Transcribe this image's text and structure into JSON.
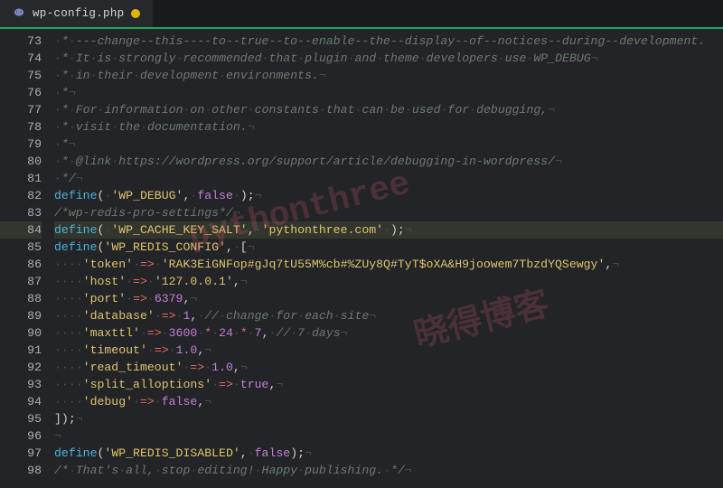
{
  "tab": {
    "filename": "wp-config.php",
    "modified": true,
    "icon": "php-elephant-icon"
  },
  "gutter": {
    "start": 73,
    "end": 98,
    "highlight": 84
  },
  "watermarks": [
    "pythonthree",
    "晓得博客"
  ],
  "handle": {
    "glyph": "‹"
  },
  "code": {
    "lines": [
      {
        "n": 73,
        "segs": [
          {
            "t": "·",
            "cls": "ws"
          },
          {
            "t": "*",
            "cls": "c"
          },
          {
            "t": "·",
            "cls": "ws"
          },
          {
            "t": "---change--this----to--true--to--enable--the--display--of--notices--during--development.",
            "cls": "c hidden"
          }
        ]
      },
      {
        "n": 74,
        "segs": [
          {
            "t": "·",
            "cls": "ws"
          },
          {
            "t": "*",
            "cls": "c"
          },
          {
            "t": "·",
            "cls": "ws"
          },
          {
            "t": "It",
            "cls": "c"
          },
          {
            "t": "·",
            "cls": "ws"
          },
          {
            "t": "is",
            "cls": "c"
          },
          {
            "t": "·",
            "cls": "ws"
          },
          {
            "t": "strongly",
            "cls": "c"
          },
          {
            "t": "·",
            "cls": "ws"
          },
          {
            "t": "recommended",
            "cls": "c"
          },
          {
            "t": "·",
            "cls": "ws"
          },
          {
            "t": "that",
            "cls": "c"
          },
          {
            "t": "·",
            "cls": "ws"
          },
          {
            "t": "plugin",
            "cls": "c"
          },
          {
            "t": "·",
            "cls": "ws"
          },
          {
            "t": "and",
            "cls": "c"
          },
          {
            "t": "·",
            "cls": "ws"
          },
          {
            "t": "theme",
            "cls": "c"
          },
          {
            "t": "·",
            "cls": "ws"
          },
          {
            "t": "developers",
            "cls": "c"
          },
          {
            "t": "·",
            "cls": "ws"
          },
          {
            "t": "use",
            "cls": "c"
          },
          {
            "t": "·",
            "cls": "ws"
          },
          {
            "t": "WP_DEBUG",
            "cls": "c"
          },
          {
            "t": "¬",
            "cls": "ws"
          }
        ]
      },
      {
        "n": 75,
        "segs": [
          {
            "t": "·",
            "cls": "ws"
          },
          {
            "t": "*",
            "cls": "c"
          },
          {
            "t": "·",
            "cls": "ws"
          },
          {
            "t": "in",
            "cls": "c"
          },
          {
            "t": "·",
            "cls": "ws"
          },
          {
            "t": "their",
            "cls": "c"
          },
          {
            "t": "·",
            "cls": "ws"
          },
          {
            "t": "development",
            "cls": "c"
          },
          {
            "t": "·",
            "cls": "ws"
          },
          {
            "t": "environments.",
            "cls": "c"
          },
          {
            "t": "¬",
            "cls": "ws"
          }
        ]
      },
      {
        "n": 76,
        "segs": [
          {
            "t": "·",
            "cls": "ws"
          },
          {
            "t": "*",
            "cls": "c"
          },
          {
            "t": "¬",
            "cls": "ws"
          }
        ]
      },
      {
        "n": 77,
        "segs": [
          {
            "t": "·",
            "cls": "ws"
          },
          {
            "t": "*",
            "cls": "c"
          },
          {
            "t": "·",
            "cls": "ws"
          },
          {
            "t": "For",
            "cls": "c"
          },
          {
            "t": "·",
            "cls": "ws"
          },
          {
            "t": "information",
            "cls": "c"
          },
          {
            "t": "·",
            "cls": "ws"
          },
          {
            "t": "on",
            "cls": "c"
          },
          {
            "t": "·",
            "cls": "ws"
          },
          {
            "t": "other",
            "cls": "c"
          },
          {
            "t": "·",
            "cls": "ws"
          },
          {
            "t": "constants",
            "cls": "c"
          },
          {
            "t": "·",
            "cls": "ws"
          },
          {
            "t": "that",
            "cls": "c"
          },
          {
            "t": "·",
            "cls": "ws"
          },
          {
            "t": "can",
            "cls": "c"
          },
          {
            "t": "·",
            "cls": "ws"
          },
          {
            "t": "be",
            "cls": "c"
          },
          {
            "t": "·",
            "cls": "ws"
          },
          {
            "t": "used",
            "cls": "c"
          },
          {
            "t": "·",
            "cls": "ws"
          },
          {
            "t": "for",
            "cls": "c"
          },
          {
            "t": "·",
            "cls": "ws"
          },
          {
            "t": "debugging,",
            "cls": "c"
          },
          {
            "t": "¬",
            "cls": "ws"
          }
        ]
      },
      {
        "n": 78,
        "segs": [
          {
            "t": "·",
            "cls": "ws"
          },
          {
            "t": "*",
            "cls": "c"
          },
          {
            "t": "·",
            "cls": "ws"
          },
          {
            "t": "visit",
            "cls": "c"
          },
          {
            "t": "·",
            "cls": "ws"
          },
          {
            "t": "the",
            "cls": "c"
          },
          {
            "t": "·",
            "cls": "ws"
          },
          {
            "t": "documentation.",
            "cls": "c"
          },
          {
            "t": "¬",
            "cls": "ws"
          }
        ]
      },
      {
        "n": 79,
        "segs": [
          {
            "t": "·",
            "cls": "ws"
          },
          {
            "t": "*",
            "cls": "c"
          },
          {
            "t": "¬",
            "cls": "ws"
          }
        ]
      },
      {
        "n": 80,
        "segs": [
          {
            "t": "·",
            "cls": "ws"
          },
          {
            "t": "*",
            "cls": "c"
          },
          {
            "t": "·",
            "cls": "ws"
          },
          {
            "t": "@link",
            "cls": "c"
          },
          {
            "t": "·",
            "cls": "ws"
          },
          {
            "t": "https://wordpress.org/support/article/debugging-in-wordpress/",
            "cls": "c"
          },
          {
            "t": "¬",
            "cls": "ws"
          }
        ]
      },
      {
        "n": 81,
        "segs": [
          {
            "t": "·",
            "cls": "ws"
          },
          {
            "t": "*/",
            "cls": "c"
          },
          {
            "t": "¬",
            "cls": "ws"
          }
        ]
      },
      {
        "n": 82,
        "segs": [
          {
            "t": "define",
            "cls": "k"
          },
          {
            "t": "(",
            "cls": "p"
          },
          {
            "t": "·",
            "cls": "ws"
          },
          {
            "t": "'WP_DEBUG'",
            "cls": "s"
          },
          {
            "t": ",",
            "cls": "p"
          },
          {
            "t": "·",
            "cls": "ws"
          },
          {
            "t": "false",
            "cls": "kw"
          },
          {
            "t": "·",
            "cls": "ws"
          },
          {
            "t": ");",
            "cls": "p"
          },
          {
            "t": "¬",
            "cls": "ws"
          }
        ]
      },
      {
        "n": 83,
        "segs": [
          {
            "t": "/*wp-redis-pro-settings*/",
            "cls": "c"
          },
          {
            "t": "¬",
            "cls": "ws"
          }
        ]
      },
      {
        "n": 84,
        "hl": true,
        "segs": [
          {
            "t": "define",
            "cls": "k"
          },
          {
            "t": "(",
            "cls": "p"
          },
          {
            "t": "·",
            "cls": "ws"
          },
          {
            "t": "'WP_CACHE_KEY_SALT'",
            "cls": "s"
          },
          {
            "t": ",",
            "cls": "p"
          },
          {
            "t": "·",
            "cls": "ws"
          },
          {
            "t": "'pythonthree.com'",
            "cls": "s"
          },
          {
            "t": "·",
            "cls": "ws"
          },
          {
            "t": ");",
            "cls": "p"
          },
          {
            "t": "¬",
            "cls": "ws"
          }
        ]
      },
      {
        "n": 85,
        "segs": [
          {
            "t": "define",
            "cls": "k"
          },
          {
            "t": "(",
            "cls": "p"
          },
          {
            "t": "'WP_REDIS_CONFIG'",
            "cls": "s"
          },
          {
            "t": ",",
            "cls": "p"
          },
          {
            "t": "·",
            "cls": "ws"
          },
          {
            "t": "[",
            "cls": "p"
          },
          {
            "t": "¬",
            "cls": "ws"
          }
        ]
      },
      {
        "n": 86,
        "segs": [
          {
            "t": "····",
            "cls": "ws"
          },
          {
            "t": "'token'",
            "cls": "s"
          },
          {
            "t": "·",
            "cls": "ws"
          },
          {
            "t": "=>",
            "cls": "op"
          },
          {
            "t": "·",
            "cls": "ws"
          },
          {
            "t": "'RAK3EiGNFop#gJq7tU55M%cb#%ZUy8Q#TyT$oXA&H9joowem7TbzdYQSewgy'",
            "cls": "s"
          },
          {
            "t": ",",
            "cls": "p"
          },
          {
            "t": "¬",
            "cls": "ws"
          }
        ]
      },
      {
        "n": 87,
        "segs": [
          {
            "t": "····",
            "cls": "ws"
          },
          {
            "t": "'host'",
            "cls": "s"
          },
          {
            "t": "·",
            "cls": "ws"
          },
          {
            "t": "=>",
            "cls": "op"
          },
          {
            "t": "·",
            "cls": "ws"
          },
          {
            "t": "'127.0.0.1'",
            "cls": "s"
          },
          {
            "t": ",",
            "cls": "p"
          },
          {
            "t": "¬",
            "cls": "ws"
          }
        ]
      },
      {
        "n": 88,
        "segs": [
          {
            "t": "····",
            "cls": "ws"
          },
          {
            "t": "'port'",
            "cls": "s"
          },
          {
            "t": "·",
            "cls": "ws"
          },
          {
            "t": "=>",
            "cls": "op"
          },
          {
            "t": "·",
            "cls": "ws"
          },
          {
            "t": "6379",
            "cls": "n"
          },
          {
            "t": ",",
            "cls": "p"
          },
          {
            "t": "¬",
            "cls": "ws"
          }
        ]
      },
      {
        "n": 89,
        "segs": [
          {
            "t": "····",
            "cls": "ws"
          },
          {
            "t": "'database'",
            "cls": "s"
          },
          {
            "t": "·",
            "cls": "ws"
          },
          {
            "t": "=>",
            "cls": "op"
          },
          {
            "t": "·",
            "cls": "ws"
          },
          {
            "t": "1",
            "cls": "n"
          },
          {
            "t": ",",
            "cls": "p"
          },
          {
            "t": "·",
            "cls": "ws"
          },
          {
            "t": "//",
            "cls": "c"
          },
          {
            "t": "·",
            "cls": "ws"
          },
          {
            "t": "change",
            "cls": "c"
          },
          {
            "t": "·",
            "cls": "ws"
          },
          {
            "t": "for",
            "cls": "c"
          },
          {
            "t": "·",
            "cls": "ws"
          },
          {
            "t": "each",
            "cls": "c"
          },
          {
            "t": "·",
            "cls": "ws"
          },
          {
            "t": "site",
            "cls": "c"
          },
          {
            "t": "¬",
            "cls": "ws"
          }
        ]
      },
      {
        "n": 90,
        "segs": [
          {
            "t": "····",
            "cls": "ws"
          },
          {
            "t": "'maxttl'",
            "cls": "s"
          },
          {
            "t": "·",
            "cls": "ws"
          },
          {
            "t": "=>",
            "cls": "op"
          },
          {
            "t": "·",
            "cls": "ws"
          },
          {
            "t": "3600",
            "cls": "n"
          },
          {
            "t": "·",
            "cls": "ws"
          },
          {
            "t": "*",
            "cls": "op"
          },
          {
            "t": "·",
            "cls": "ws"
          },
          {
            "t": "24",
            "cls": "n"
          },
          {
            "t": "·",
            "cls": "ws"
          },
          {
            "t": "*",
            "cls": "op"
          },
          {
            "t": "·",
            "cls": "ws"
          },
          {
            "t": "7",
            "cls": "n"
          },
          {
            "t": ",",
            "cls": "p"
          },
          {
            "t": "·",
            "cls": "ws"
          },
          {
            "t": "//",
            "cls": "c"
          },
          {
            "t": "·",
            "cls": "ws"
          },
          {
            "t": "7",
            "cls": "c"
          },
          {
            "t": "·",
            "cls": "ws"
          },
          {
            "t": "days",
            "cls": "c"
          },
          {
            "t": "¬",
            "cls": "ws"
          }
        ]
      },
      {
        "n": 91,
        "segs": [
          {
            "t": "····",
            "cls": "ws"
          },
          {
            "t": "'timeout'",
            "cls": "s"
          },
          {
            "t": "·",
            "cls": "ws"
          },
          {
            "t": "=>",
            "cls": "op"
          },
          {
            "t": "·",
            "cls": "ws"
          },
          {
            "t": "1.0",
            "cls": "n"
          },
          {
            "t": ",",
            "cls": "p"
          },
          {
            "t": "¬",
            "cls": "ws"
          }
        ]
      },
      {
        "n": 92,
        "segs": [
          {
            "t": "····",
            "cls": "ws"
          },
          {
            "t": "'read_timeout'",
            "cls": "s"
          },
          {
            "t": "·",
            "cls": "ws"
          },
          {
            "t": "=>",
            "cls": "op"
          },
          {
            "t": "·",
            "cls": "ws"
          },
          {
            "t": "1.0",
            "cls": "n"
          },
          {
            "t": ",",
            "cls": "p"
          },
          {
            "t": "¬",
            "cls": "ws"
          }
        ]
      },
      {
        "n": 93,
        "segs": [
          {
            "t": "····",
            "cls": "ws"
          },
          {
            "t": "'split_alloptions'",
            "cls": "s"
          },
          {
            "t": "·",
            "cls": "ws"
          },
          {
            "t": "=>",
            "cls": "op"
          },
          {
            "t": "·",
            "cls": "ws"
          },
          {
            "t": "true",
            "cls": "kw"
          },
          {
            "t": ",",
            "cls": "p"
          },
          {
            "t": "¬",
            "cls": "ws"
          }
        ]
      },
      {
        "n": 94,
        "segs": [
          {
            "t": "····",
            "cls": "ws"
          },
          {
            "t": "'debug'",
            "cls": "s"
          },
          {
            "t": "·",
            "cls": "ws"
          },
          {
            "t": "=>",
            "cls": "op"
          },
          {
            "t": "·",
            "cls": "ws"
          },
          {
            "t": "false",
            "cls": "kw"
          },
          {
            "t": ",",
            "cls": "p"
          },
          {
            "t": "¬",
            "cls": "ws"
          }
        ]
      },
      {
        "n": 95,
        "segs": [
          {
            "t": "]);",
            "cls": "p"
          },
          {
            "t": "¬",
            "cls": "ws"
          }
        ]
      },
      {
        "n": 96,
        "segs": [
          {
            "t": "¬",
            "cls": "ws"
          }
        ]
      },
      {
        "n": 97,
        "segs": [
          {
            "t": "define",
            "cls": "k"
          },
          {
            "t": "(",
            "cls": "p"
          },
          {
            "t": "'WP_REDIS_DISABLED'",
            "cls": "s"
          },
          {
            "t": ",",
            "cls": "p"
          },
          {
            "t": "·",
            "cls": "ws"
          },
          {
            "t": "false",
            "cls": "kw"
          },
          {
            "t": ");",
            "cls": "p"
          },
          {
            "t": "¬",
            "cls": "ws"
          }
        ]
      },
      {
        "n": 98,
        "segs": [
          {
            "t": "/*",
            "cls": "c"
          },
          {
            "t": "·",
            "cls": "ws"
          },
          {
            "t": "That's",
            "cls": "c"
          },
          {
            "t": "·",
            "cls": "ws"
          },
          {
            "t": "all,",
            "cls": "c"
          },
          {
            "t": "·",
            "cls": "ws"
          },
          {
            "t": "stop",
            "cls": "c"
          },
          {
            "t": "·",
            "cls": "ws"
          },
          {
            "t": "editing!",
            "cls": "c"
          },
          {
            "t": "·",
            "cls": "ws"
          },
          {
            "t": "Happy",
            "cls": "c"
          },
          {
            "t": "·",
            "cls": "ws"
          },
          {
            "t": "publishing.",
            "cls": "c"
          },
          {
            "t": "·",
            "cls": "ws"
          },
          {
            "t": "*/",
            "cls": "c"
          },
          {
            "t": "¬",
            "cls": "ws"
          }
        ]
      }
    ]
  }
}
